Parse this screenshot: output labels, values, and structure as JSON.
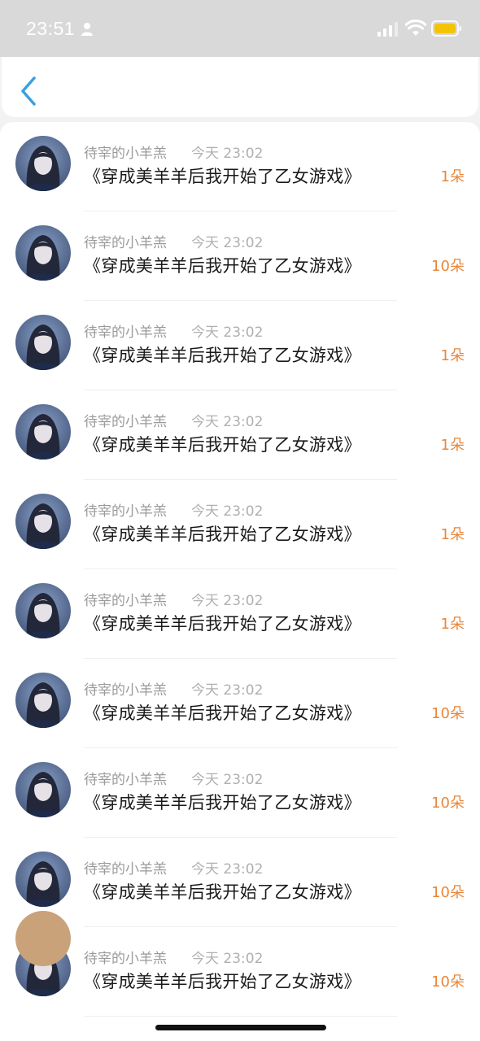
{
  "status_bar": {
    "time": "23:51",
    "battery_color": "#f5c400"
  },
  "nav": {
    "back_icon": "chevron-left-icon",
    "accent_color": "#3aa0e0"
  },
  "records": [
    {
      "username": "待宰的小羊羔",
      "time": "今天 23:02",
      "book": "《穿成美羊羊后我开始了乙女游戏》",
      "count": "1朵"
    },
    {
      "username": "待宰的小羊羔",
      "time": "今天 23:02",
      "book": "《穿成美羊羊后我开始了乙女游戏》",
      "count": "10朵"
    },
    {
      "username": "待宰的小羊羔",
      "time": "今天 23:02",
      "book": "《穿成美羊羊后我开始了乙女游戏》",
      "count": "1朵"
    },
    {
      "username": "待宰的小羊羔",
      "time": "今天 23:02",
      "book": "《穿成美羊羊后我开始了乙女游戏》",
      "count": "1朵"
    },
    {
      "username": "待宰的小羊羔",
      "time": "今天 23:02",
      "book": "《穿成美羊羊后我开始了乙女游戏》",
      "count": "1朵"
    },
    {
      "username": "待宰的小羊羔",
      "time": "今天 23:02",
      "book": "《穿成美羊羊后我开始了乙女游戏》",
      "count": "1朵"
    },
    {
      "username": "待宰的小羊羔",
      "time": "今天 23:02",
      "book": "《穿成美羊羊后我开始了乙女游戏》",
      "count": "10朵"
    },
    {
      "username": "待宰的小羊羔",
      "time": "今天 23:02",
      "book": "《穿成美羊羊后我开始了乙女游戏》",
      "count": "10朵"
    },
    {
      "username": "待宰的小羊羔",
      "time": "今天 23:02",
      "book": "《穿成美羊羊后我开始了乙女游戏》",
      "count": "10朵"
    },
    {
      "username": "待宰的小羊羔",
      "time": "今天 23:02",
      "book": "《穿成美羊羊后我开始了乙女游戏》",
      "count": "10朵"
    }
  ]
}
